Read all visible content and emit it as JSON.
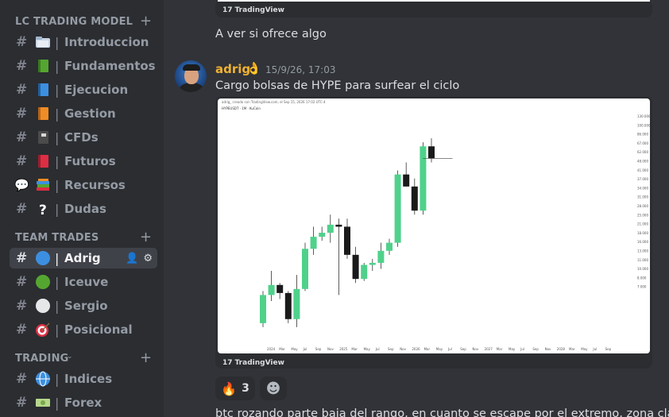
{
  "sidebar": {
    "categories": [
      {
        "label": "LC TRADING MODEL",
        "plus": "+",
        "chevron": "⌄"
      },
      {
        "label": "TEAM TRADES",
        "plus": "+",
        "chevron": "⌄"
      },
      {
        "label": "TRADING",
        "plus": "+",
        "chevron": "⌄"
      }
    ],
    "channels": [
      {
        "name": "Introduccion",
        "emoji": "folder",
        "hash": "#",
        "sep": "|"
      },
      {
        "name": "Fundamentos",
        "emoji": "green-book",
        "hash": "#",
        "sep": "|"
      },
      {
        "name": "Ejecucion",
        "emoji": "blue-book",
        "hash": "#",
        "sep": "|"
      },
      {
        "name": "Gestion",
        "emoji": "orange-book",
        "hash": "#",
        "sep": "|"
      },
      {
        "name": "CFDs",
        "emoji": "notebook",
        "hash": "#",
        "sep": "|"
      },
      {
        "name": "Futuros",
        "emoji": "red-book",
        "hash": "#",
        "sep": "|"
      },
      {
        "name": "Recursos",
        "emoji": "books",
        "hash": "#",
        "sep": "|"
      },
      {
        "name": "Dudas",
        "emoji": "question-mark",
        "hash": "#",
        "sep": "|"
      },
      {
        "name": "Adrig",
        "emoji": "blue-circle",
        "hash": "#",
        "sep": "|"
      },
      {
        "name": "Iceuve",
        "emoji": "green-circle",
        "hash": "#",
        "sep": "|"
      },
      {
        "name": "Sergio",
        "emoji": "white-circle",
        "hash": "#",
        "sep": "|"
      },
      {
        "name": "Posicional",
        "emoji": "direct-hit",
        "hash": "#",
        "sep": "|"
      },
      {
        "name": "Indices",
        "emoji": "globe",
        "hash": "#",
        "sep": "|"
      },
      {
        "name": "Forex",
        "emoji": "money",
        "hash": "#",
        "sep": "|"
      }
    ]
  },
  "chat": {
    "top_embed_logo": "TradingView",
    "msg1_text": "A ver si ofrece algo",
    "author": "adrig",
    "badge": "👌",
    "timestamp": "15/9/26, 17:03",
    "msg2_text": "Cargo bolsas de HYPE para surfear el ciclo",
    "chart_embed_logo": "TradingView",
    "chart_header_1": "adrig_ creado con TradingView.com, el Sep 15, 2026 17:02 UTC-4",
    "chart_header_2": "HYPEUSDT · 1M · KuCoin",
    "reaction_emoji": "🔥",
    "reaction_count": "3",
    "add_reaction_icon": "☻",
    "msg3_text": "btc rozando parte baja del rango, en cuanto se escape por el extremo, zona clave, si v"
  },
  "chart_data": {
    "type": "candlestick",
    "candles": [
      {
        "o": 10,
        "h": 18,
        "l": 9,
        "c": 17,
        "dir": "up"
      },
      {
        "o": 17,
        "h": 23,
        "l": 15.5,
        "c": 19.5,
        "dir": "up"
      },
      {
        "o": 19.5,
        "h": 20,
        "l": 16,
        "c": 17.5,
        "dir": "down"
      },
      {
        "o": 17.5,
        "h": 18,
        "l": 10,
        "c": 11,
        "dir": "down"
      },
      {
        "o": 11,
        "h": 22,
        "l": 9,
        "c": 18.5,
        "dir": "up"
      },
      {
        "o": 18.5,
        "h": 30,
        "l": 18,
        "c": 28.5,
        "dir": "up"
      },
      {
        "o": 28.5,
        "h": 34,
        "l": 27,
        "c": 31.5,
        "dir": "up"
      },
      {
        "o": 31.5,
        "h": 34,
        "l": 30.5,
        "c": 32.5,
        "dir": "up"
      },
      {
        "o": 32.5,
        "h": 37,
        "l": 30,
        "c": 34.5,
        "dir": "up"
      },
      {
        "o": 34.5,
        "h": 36,
        "l": 17,
        "c": 34,
        "dir": "down"
      },
      {
        "o": 34,
        "h": 36,
        "l": 26,
        "c": 27,
        "dir": "down"
      },
      {
        "o": 27,
        "h": 29,
        "l": 20,
        "c": 21,
        "dir": "down"
      },
      {
        "o": 21,
        "h": 25,
        "l": 20.5,
        "c": 24.5,
        "dir": "up"
      },
      {
        "o": 24.5,
        "h": 26,
        "l": 23,
        "c": 25,
        "dir": "up"
      },
      {
        "o": 25,
        "h": 30,
        "l": 23.5,
        "c": 28,
        "dir": "up"
      },
      {
        "o": 28,
        "h": 31,
        "l": 27,
        "c": 30,
        "dir": "up"
      },
      {
        "o": 30,
        "h": 48,
        "l": 29,
        "c": 47,
        "dir": "up"
      },
      {
        "o": 47,
        "h": 50,
        "l": 44,
        "c": 44,
        "dir": "down"
      },
      {
        "o": 44,
        "h": 46,
        "l": 37,
        "c": 38,
        "dir": "down"
      },
      {
        "o": 38,
        "h": 55,
        "l": 37,
        "c": 54,
        "dir": "up"
      },
      {
        "o": 54,
        "h": 56,
        "l": 50,
        "c": 51,
        "dir": "down"
      }
    ],
    "price_labels": [
      "130.000",
      "100.000",
      "86.000",
      "67.000",
      "62.000",
      "48.000",
      "41.000",
      "37.000",
      "34.000",
      "31.000",
      "28.000",
      "25.000",
      "21.000",
      "18.000",
      "16.000",
      "13.000",
      "11.000",
      "10.000",
      "8.000",
      "7.000"
    ],
    "time_labels": [
      "2024",
      "Mar",
      "May",
      "Jul",
      "Sep",
      "Nov",
      "2025",
      "Mar",
      "May",
      "Jul",
      "Sep",
      "Nov",
      "2026",
      "Mar",
      "May",
      "Jul",
      "Sep",
      "Nov",
      "2027",
      "Mar",
      "May",
      "Jul",
      "Sep",
      "Nov",
      "2028",
      "Mar",
      "May",
      "Jul",
      "Sep"
    ],
    "colors": {
      "up": "#4fd18b",
      "down": "#1a1a1a"
    },
    "ylim": [
      7,
      58
    ]
  }
}
